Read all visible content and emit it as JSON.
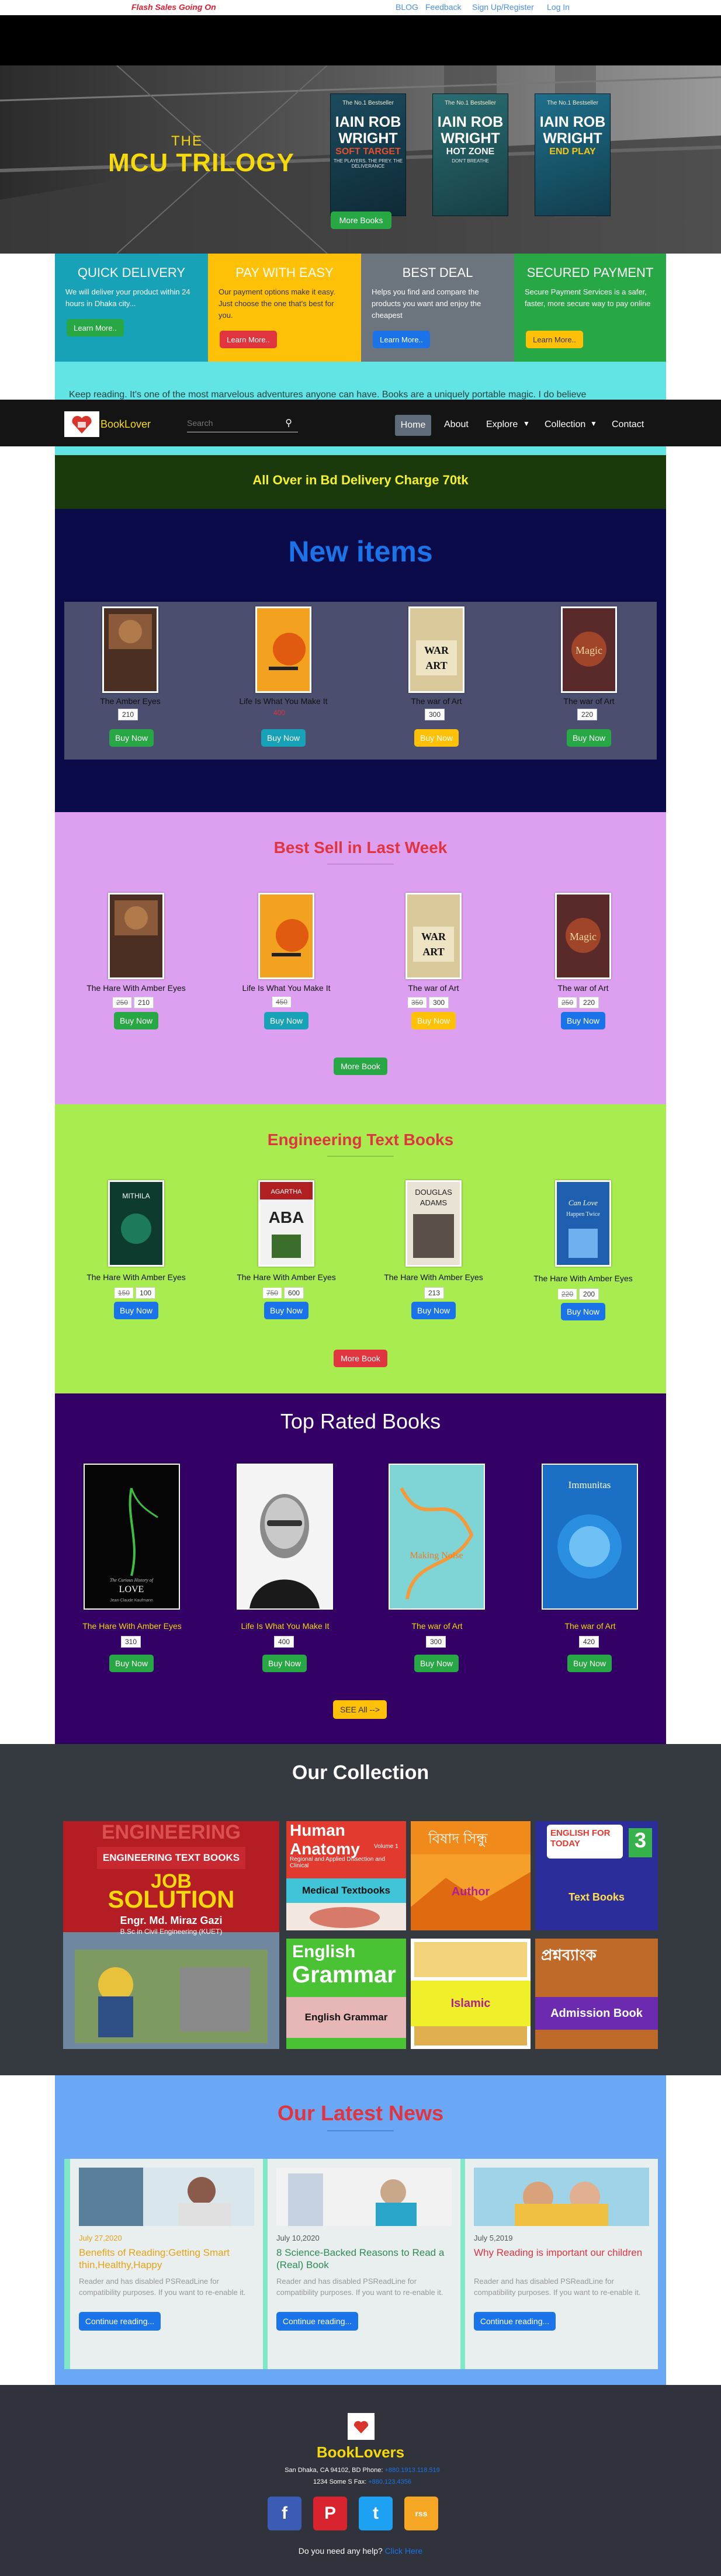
{
  "topbar": {
    "flash": "Flash Sales Going On",
    "links": [
      "BLOG",
      "Feedback",
      "Sign Up/Register",
      "Log In"
    ]
  },
  "hero": {
    "title_the": "THE",
    "title_main": "MCU TRILOGY",
    "books": [
      {
        "kicker": "The No.1 Bestseller",
        "author": "IAIN ROB WRIGHT",
        "title": "SOFT TARGET",
        "title_color": "#e94e2c",
        "tagline": "THE PLAYERS. THE PREY. THE DELIVERANCE"
      },
      {
        "kicker": "The No.1 Bestseller",
        "author": "IAIN ROB WRIGHT",
        "title": "HOT ZONE",
        "title_color": "#f5f5f5",
        "tagline": "DON'T BREATHE"
      },
      {
        "kicker": "The No.1 Bestseller",
        "author": "IAIN ROB WRIGHT",
        "title": "END PLAY",
        "title_color": "#f5c518",
        "tagline": ""
      }
    ],
    "cta": "More Books"
  },
  "features": [
    {
      "title": "QUICK DELIVERY",
      "desc": "We will deliver your product within 24 hours in Dhaka city...",
      "button": "Learn More..",
      "bg": "#17a2b8",
      "btn_color": "#28a745"
    },
    {
      "title": "PAY WITH EASY",
      "desc": "Our payment options make it easy. Just choose the one that's best for you.",
      "button": "Learn More..",
      "bg": "#ffc107",
      "btn_color": "#e0343f"
    },
    {
      "title": "BEST DEAL",
      "desc": "Helps you find and compare the products you want and enjoy the cheapest",
      "button": "Learn More..",
      "bg": "#6c757d",
      "btn_color": "#1a73e8"
    },
    {
      "title": "SECURED PAYMENT",
      "desc": "Secure Payment Services is a safer, faster, more secure way to pay online",
      "button": "Learn More..",
      "bg": "#28a745",
      "btn_color": "#ffc107"
    }
  ],
  "ticker": "Keep reading. It's one of the most marvelous adventures anyone can have. Books are a uniquely portable magic. I do believe",
  "nav": {
    "brand": "BookLover",
    "search_placeholder": "Search",
    "items": [
      "Home",
      "About",
      "Explore",
      "Collection",
      "Contact"
    ]
  },
  "delivery_banner": "All Over in Bd Delivery Charge 70tk",
  "new_items": {
    "title": "New items",
    "books": [
      {
        "name": "The Amber Eyes",
        "old": "",
        "price": "210",
        "button": "Buy Now",
        "btn_color": "#28a745",
        "price_color": "#333"
      },
      {
        "name": "Life Is What You Make It",
        "old": "",
        "price": "400",
        "button": "Buy Now",
        "btn_color": "#17a2b8",
        "price_color": "#e0343f"
      },
      {
        "name": "The war of Art",
        "old": "",
        "price": "300",
        "button": "Buy Now",
        "btn_color": "#ffc107",
        "price_color": "#333"
      },
      {
        "name": "The war of Art",
        "old": "",
        "price": "220",
        "button": "Buy Now",
        "btn_color": "#28a745",
        "price_color": "#333"
      }
    ]
  },
  "best_sell": {
    "title": "Best Sell in Last Week",
    "books": [
      {
        "name": "The Hare With Amber Eyes",
        "old": "250",
        "price": "210",
        "button": "Buy Now",
        "btn_color": "#28a745"
      },
      {
        "name": "Life Is What You Make It",
        "old": "450",
        "price": "",
        "button": "Buy Now",
        "btn_color": "#17a2b8"
      },
      {
        "name": "The war of Art",
        "old": "350",
        "price": "300",
        "button": "Buy Now",
        "btn_color": "#ffc107"
      },
      {
        "name": "The war of Art",
        "old": "250",
        "price": "220",
        "button": "Buy Now",
        "btn_color": "#1a73e8"
      }
    ],
    "more": "More Book"
  },
  "engineering": {
    "title": "Engineering Text Books",
    "books": [
      {
        "name": "The Hare With Amber Eyes",
        "old": "150",
        "price": "100",
        "button": "Buy Now",
        "btn_color": "#1a73e8"
      },
      {
        "name": "The Hare With Amber Eyes",
        "old": "750",
        "price": "600",
        "button": "Buy Now",
        "btn_color": "#1a73e8"
      },
      {
        "name": "The Hare With Amber Eyes",
        "old": "",
        "price": "213",
        "button": "Buy Now",
        "btn_color": "#1a73e8"
      },
      {
        "name": "The Hare With Amber Eyes",
        "old": "220",
        "price": "200",
        "button": "Buy Now",
        "btn_color": "#1a73e8"
      }
    ],
    "more": "More Book",
    "covers": [
      {
        "l1": "MITHILA",
        "l2": ""
      },
      {
        "l1": "AGARTHA",
        "l2": "ABA"
      },
      {
        "l1": "DOUGLAS",
        "l2": "ADAMS"
      },
      {
        "l1": "Can Love",
        "l2": "Happen Twice"
      }
    ]
  },
  "top_rated": {
    "title": "Top Rated Books",
    "books": [
      {
        "name": "The Hare With Amber Eyes",
        "price": "310",
        "button": "Buy Now"
      },
      {
        "name": "Life Is What You Make It",
        "price": "400",
        "button": "Buy Now"
      },
      {
        "name": "The war of Art",
        "price": "300",
        "button": "Buy Now"
      },
      {
        "name": "The war of Art",
        "price": "420",
        "button": "Buy Now"
      }
    ],
    "see_all": "SEE All -->",
    "covers": [
      {
        "l1": "The Curious History of",
        "l2": "LOVE",
        "l3": "Jean-Claude Kaufmann"
      },
      {
        "l1": "",
        "l2": "",
        "l3": ""
      },
      {
        "l1": "Making Noise",
        "l2": "",
        "l3": ""
      },
      {
        "l1": "Immunitas",
        "l2": "",
        "l3": ""
      }
    ]
  },
  "collection": {
    "title": "Our Collection",
    "items": [
      {
        "label": "ENGINEERING TEXT BOOKS",
        "deco1": "ENGINEERING",
        "deco2": "JOB",
        "deco3": "SOLUTION",
        "deco4": "Engr. Md. Miraz Gazi",
        "deco5": "B.Sc in Civil Engineering (KUET)"
      },
      {
        "label": "Medical Textbooks",
        "deco1": "Human Anatomy",
        "deco2": "Volume 1",
        "deco3": "Regional and Applied Dissection and Clinical"
      },
      {
        "label": "Author",
        "deco1": "বিষাদ সিন্ধু"
      },
      {
        "label": "Text Books",
        "deco1": "ENGLISH FOR TODAY",
        "deco2": "3"
      },
      {
        "label": "English Grammar",
        "deco1": "English",
        "deco2": "Grammar"
      },
      {
        "label": "Islamic",
        "deco1": ""
      },
      {
        "label": "Admission Book",
        "deco1": "প্রশ্নব্যাংক"
      }
    ]
  },
  "news": {
    "title": "Our Latest News",
    "items": [
      {
        "date": "July 27,2020",
        "title": "Benefits of Reading:Getting Smart thin,Healthy,Happy",
        "title_color": "#e8a317",
        "text": "Reader and has disabled PSReadLine for compatibility purposes. If you want to re-enable it.",
        "button": "Continue reading..."
      },
      {
        "date": "July 10,2020",
        "title": "8 Science-Backed Reasons to Read a (Real) Book",
        "title_color": "#2e8b57",
        "text": "Reader and has disabled PSReadLine for compatibility purposes. If you want to re-enable it.",
        "button": "Continue reading..."
      },
      {
        "date": "July 5,2019",
        "title": "Why Reading is important our children",
        "title_color": "#e0343f",
        "text": "Reader and has disabled PSReadLine for compatibility purposes. If you want to re-enable it.",
        "button": "Continue reading..."
      }
    ]
  },
  "footer": {
    "brand": "BookLovers",
    "address": "San Dhaka, CA 94102, BD Phone:",
    "phone": "+880.1913.118.519",
    "address2": "1234 Some S Fax:",
    "fax": "+880.123.4356",
    "help": "Do you need any help?",
    "help_link": "Click Here",
    "social": [
      "f",
      "P",
      "t",
      "rss"
    ]
  },
  "colors": {
    "navy": "#0b0b4a",
    "pink": "#dda0f0",
    "lime": "#a8ec50",
    "purple": "#330066",
    "slate": "#343a40",
    "skyblue": "#6aa8f5",
    "footer": "#30333b"
  }
}
